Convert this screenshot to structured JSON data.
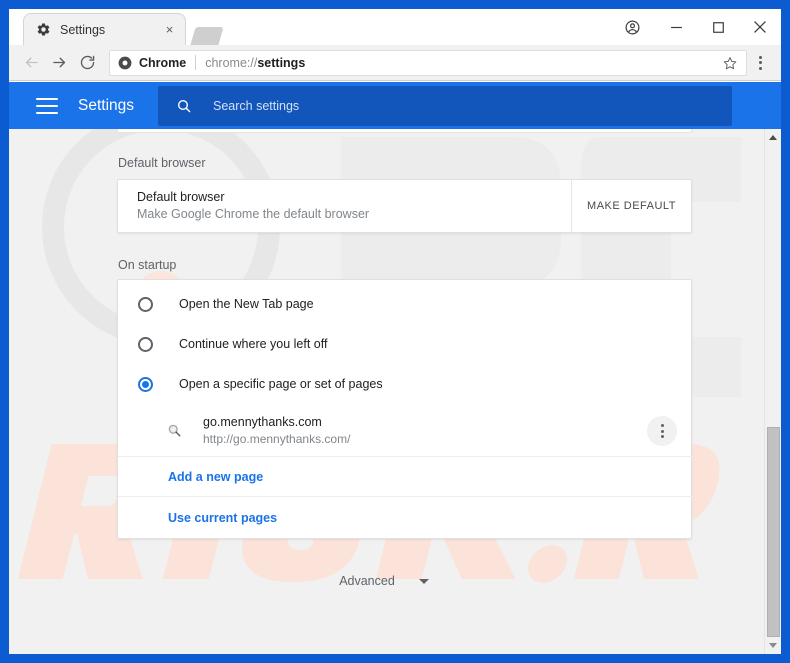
{
  "browser": {
    "tab": {
      "title": "Settings",
      "favicon": "gear-icon",
      "close": "×"
    },
    "window_controls": {
      "profile": "profile-icon",
      "minimize": "–",
      "maximize": "□",
      "close": "×"
    },
    "toolbar": {
      "back": "back-arrow-icon",
      "forward": "forward-arrow-icon",
      "reload": "reload-icon",
      "omnibox": {
        "security_icon": "chrome-icon",
        "scheme_label": "Chrome",
        "url_prefix": "chrome://",
        "url_bold": "settings",
        "star_icon": "star-icon"
      },
      "menu_icon": "three-dot-menu-icon"
    }
  },
  "settings_header": {
    "menu_icon": "hamburger-icon",
    "title": "Settings",
    "search_icon": "search-icon",
    "search_placeholder": "Search settings"
  },
  "sections": {
    "default_browser": {
      "label": "Default browser",
      "row_title": "Default browser",
      "row_subtitle": "Make Google Chrome the default browser",
      "button_label": "MAKE DEFAULT"
    },
    "on_startup": {
      "label": "On startup",
      "options": [
        {
          "label": "Open the New Tab page",
          "checked": false
        },
        {
          "label": "Continue where you left off",
          "checked": false
        },
        {
          "label": "Open a specific page or set of pages",
          "checked": true
        }
      ],
      "startup_pages": [
        {
          "favicon": "magnifier-icon",
          "name": "go.mennythanks.com",
          "url": "http://go.mennythanks.com/",
          "menu_icon": "three-dot-menu-icon"
        }
      ],
      "add_page_link": "Add a new page",
      "use_current_link": "Use current pages"
    }
  },
  "footer": {
    "advanced_label": "Advanced",
    "advanced_chevron": "chevron-down-icon"
  },
  "scrollbar": {
    "up_arrow": "scroll-up-arrow-icon",
    "down_arrow": "scroll-down-arrow-icon"
  },
  "colors": {
    "window_frame": "#0d5bd1",
    "settings_header": "#1a73e8",
    "search_box": "#1256bc",
    "accent": "#1a73e8",
    "body_bg": "#f1f1f1",
    "card_bg": "#ffffff"
  }
}
